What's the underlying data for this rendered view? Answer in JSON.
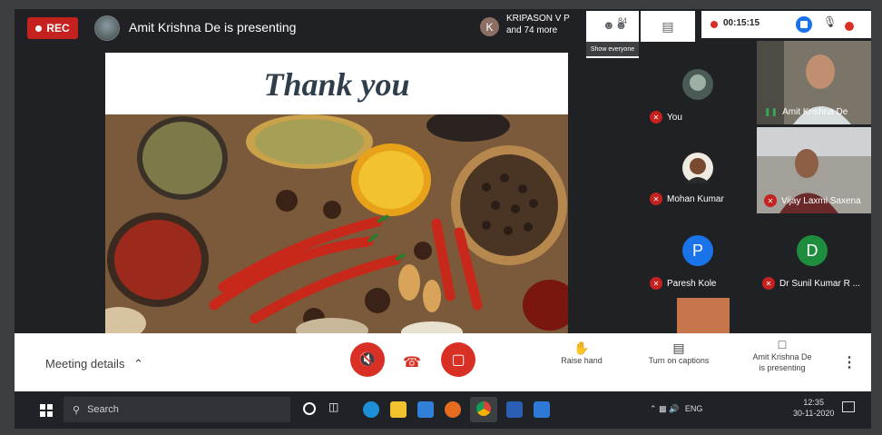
{
  "top_bar": {
    "rec_label": "REC",
    "presenting_title": "Amit Krishna De is presenting",
    "participant_initial": "K",
    "participant_name": "KRIPASON V P",
    "participant_more": "and 74 more",
    "people_count": "84",
    "tooltip": "Show everyone",
    "timer": "00:15:15"
  },
  "slide": {
    "title": "Thank you",
    "image_label": "spices photo"
  },
  "participants": [
    {
      "name": "You",
      "muted": true
    },
    {
      "name": "Amit Krishna De"
    },
    {
      "name": "Mohan Kumar",
      "muted": true
    },
    {
      "name": "Vijay Laxmi Saxena",
      "muted": true
    },
    {
      "name": "Paresh Kole",
      "initial": "P",
      "color": "#1a73e8",
      "muted": true
    },
    {
      "name": "Dr Sunil Kumar R ...",
      "initial": "D",
      "color": "#1e8e3e",
      "muted": true
    }
  ],
  "bottom_bar": {
    "meeting_details": "Meeting details",
    "raise_hand": "Raise hand",
    "captions": "Turn on captions",
    "presenting_line1": "Amit Krishna De",
    "presenting_line2": "is presenting"
  },
  "taskbar": {
    "search_placeholder": "Search",
    "lang": "ENG",
    "time": "12:35",
    "date": "30-11-2020"
  },
  "colors": {
    "rec_red": "#c5221f",
    "meet_blue": "#1a73e8",
    "avatar_green": "#1e8e3e"
  }
}
